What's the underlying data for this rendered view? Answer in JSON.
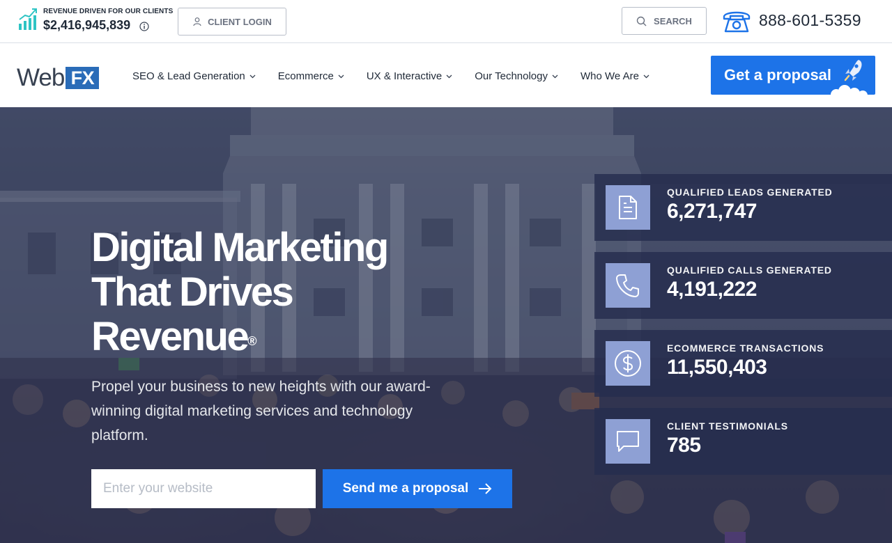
{
  "topbar": {
    "revenue_label": "REVENUE DRIVEN FOR OUR CLIENTS",
    "revenue_value": "$2,416,945,839",
    "client_login": "CLIENT LOGIN",
    "search": "SEARCH",
    "phone": "888-601-5359"
  },
  "logo": {
    "web": "Web",
    "fx": "FX"
  },
  "nav": {
    "items": [
      {
        "label": "SEO & Lead Generation"
      },
      {
        "label": "Ecommerce"
      },
      {
        "label": "UX & Interactive"
      },
      {
        "label": "Our Technology"
      },
      {
        "label": "Who We Are"
      }
    ],
    "cta": "Get a proposal"
  },
  "hero": {
    "title_line1": "Digital Marketing",
    "title_line2": "That Drives",
    "title_line3": "Revenue",
    "registered": "®",
    "subtitle": "Propel your business to new heights with our award-winning digital marketing services and technology platform.",
    "input_placeholder": "Enter your website",
    "button": "Send me a proposal"
  },
  "stats": [
    {
      "label": "QUALIFIED LEADS GENERATED",
      "value": "6,271,747",
      "icon": "document-icon"
    },
    {
      "label": "QUALIFIED CALLS GENERATED",
      "value": "4,191,222",
      "icon": "phone-icon"
    },
    {
      "label": "ECOMMERCE TRANSACTIONS",
      "value": "11,550,403",
      "icon": "dollar-icon"
    },
    {
      "label": "CLIENT TESTIMONIALS",
      "value": "785",
      "icon": "chat-icon"
    }
  ],
  "colors": {
    "brand_blue": "#1d73e8",
    "logo_blue": "#2a6cb8",
    "stat_icon_bg": "#8ea0d4",
    "accent_teal": "#2ec4c4"
  }
}
